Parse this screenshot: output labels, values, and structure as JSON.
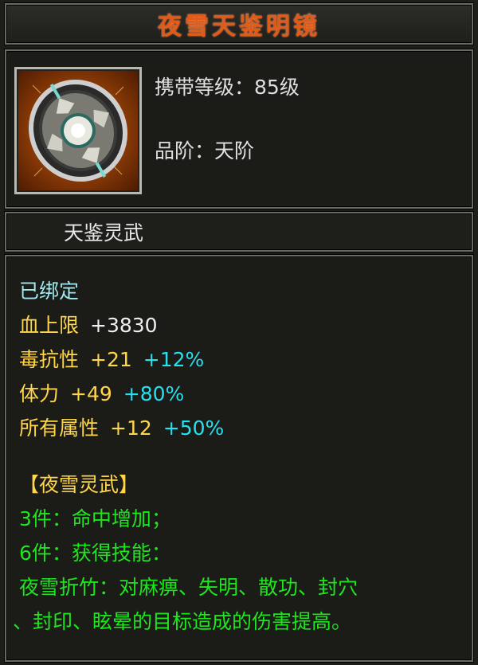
{
  "item": {
    "name": "夜雪天鉴明镜",
    "level_label": "携带等级：",
    "level_value": "85级",
    "grade_label": "品阶：",
    "grade_value": "天阶",
    "category": "天鉴灵武",
    "icon": "mirror-shield-icon"
  },
  "stats": {
    "bound": "已绑定",
    "attrs": [
      {
        "name": "血上限",
        "value": "+3830",
        "pct": ""
      },
      {
        "name": "毒抗性",
        "value": "+21",
        "pct": "+12%"
      },
      {
        "name": "体力",
        "value": "+49",
        "pct": "+80%"
      },
      {
        "name": "所有属性",
        "value": "+12",
        "pct": "+50%"
      }
    ]
  },
  "set": {
    "title": "【夜雪灵武】",
    "bonus_3": "3件：命中增加；",
    "bonus_6": "6件：获得技能：",
    "skill_line1": "夜雪折竹：对麻痹、失明、散功、封穴",
    "skill_line2": "、封印、眩晕的目标造成的伤害提高。"
  },
  "colors": {
    "title": "#e05a18",
    "bound": "#9fe8f0",
    "attr": "#ffd54a",
    "percent": "#26e0ee",
    "set": "#1ee61e"
  }
}
